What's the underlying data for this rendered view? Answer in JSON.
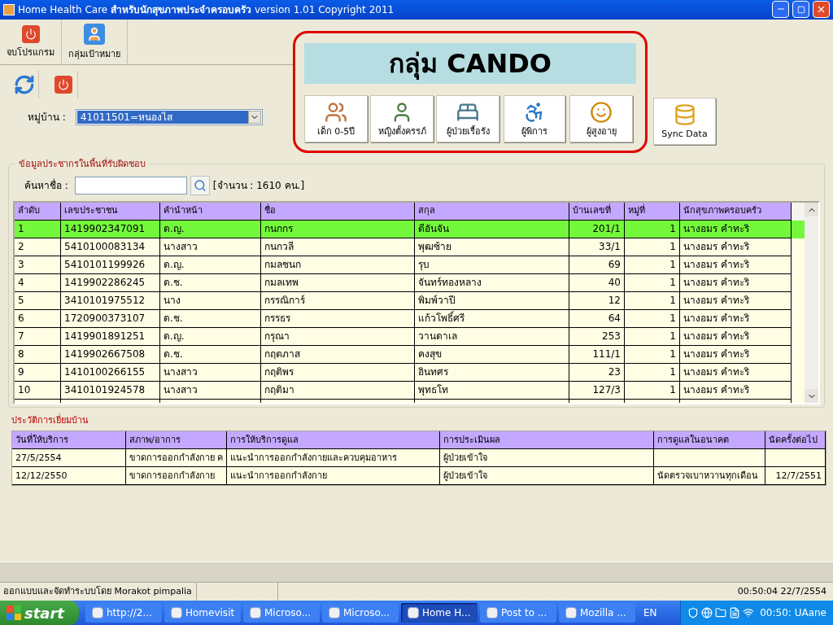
{
  "window": {
    "title": "Home Health Care **สำหรับนักสุขภาพประจำครอบครัว** version 1.01  Copyright 2011"
  },
  "toolbar": [
    {
      "label": "จบโปรแกรม",
      "kind": "power"
    },
    {
      "label": "กลุ่มเป้าหมาย",
      "kind": "person"
    }
  ],
  "village": {
    "label": "หมู่บ้าน :",
    "value": "41011501=หนองไส"
  },
  "cando": {
    "title": "กลุ่ม CANDO",
    "groups": [
      {
        "label": "เด็ก 0-5ปี",
        "kind": "children"
      },
      {
        "label": "หญิงตั้งครรภ์",
        "kind": "woman"
      },
      {
        "label": "ผู้ป่วยเรื้อรัง",
        "kind": "patient"
      },
      {
        "label": "ผู้พิการ",
        "kind": "disabled"
      },
      {
        "label": "ผู้สูงอายุ",
        "kind": "elder"
      }
    ],
    "sync_button": "Sync Data"
  },
  "population": {
    "legend": "ข้อมูลประชากรในพื้นที่รับผิดชอบ",
    "search": {
      "label": "ค้นหาชื่อ :"
    },
    "count": "[จำนวน : 1610 คน.]",
    "table": {
      "columns": [
        "ลำดับ",
        "เลขประชาชน",
        "คำนำหน้า",
        "ชื่อ",
        "สกุล",
        "บ้านเลขที่",
        "หมู่ที่",
        "นักสุขภาพครอบครัว"
      ],
      "rows": [
        {
          "selected": true,
          "cells": [
            "1",
            "1419902347091",
            "ด.ญ.",
            "กนกกร",
            "ดีอันจัน",
            "201/1",
            "1",
            "นางอมร  คำทะริ"
          ]
        },
        {
          "selected": false,
          "cells": [
            "2",
            "5410100083134",
            "นางสาว",
            "กนกวลี",
            "พุฒซ้าย",
            "33/1",
            "1",
            "นางอมร  คำทะริ"
          ]
        },
        {
          "selected": false,
          "cells": [
            "3",
            "5410101199926",
            "ด.ญ.",
            "กมลชนก",
            "รุบ",
            "69",
            "1",
            "นางอมร  คำทะริ"
          ]
        },
        {
          "selected": false,
          "cells": [
            "4",
            "1419902286245",
            "ด.ช.",
            "กมลเทพ",
            "จันทร์ทองหลาง",
            "40",
            "1",
            "นางอมร  คำทะริ"
          ]
        },
        {
          "selected": false,
          "cells": [
            "5",
            "3410101975512",
            "นาง",
            "กรรณิการ์",
            "พิมพ์วาปี",
            "12",
            "1",
            "นางอมร  คำทะริ"
          ]
        },
        {
          "selected": false,
          "cells": [
            "6",
            "1720900373107",
            "ด.ช.",
            "กรรธร",
            "แก้วโพธิ์ศรี",
            "64",
            "1",
            "นางอมร  คำทะริ"
          ]
        },
        {
          "selected": false,
          "cells": [
            "7",
            "1419901891251",
            "ด.ญ.",
            "กรุณา",
            "วานดาเล",
            "253",
            "1",
            "นางอมร  คำทะริ"
          ]
        },
        {
          "selected": false,
          "cells": [
            "8",
            "1419902667508",
            "ด.ช.",
            "กฤตภาส",
            "คงสุข",
            "111/1",
            "1",
            "นางอมร  คำทะริ"
          ]
        },
        {
          "selected": false,
          "cells": [
            "9",
            "1410100266155",
            "นางสาว",
            "กฤติพร",
            "อินทศร",
            "23",
            "1",
            "นางอมร  คำทะริ"
          ]
        },
        {
          "selected": false,
          "cells": [
            "10",
            "3410101924578",
            "นางสาว",
            "กฤติมา",
            "พุทธโท",
            "127/3",
            "1",
            "นางอมร  คำทะริ"
          ]
        }
      ]
    }
  },
  "history": {
    "title": "ประวัติการเยี่ยมบ้าน",
    "table": {
      "columns": [
        "วันที่ให้บริการ",
        "สภาพ/อาการ",
        "การให้บริการดูแล",
        "การประเมินผล",
        "การดูแลในอนาคต",
        "นัดครั้งต่อไป"
      ],
      "rows": [
        {
          "cells": [
            "27/5/2554",
            "ขาดการออกกำลังกาย ค",
            "แนะนำการออกกำลังกายและควบคุมอาหาร",
            "ผู้ป่วยเข้าใจ",
            "",
            ""
          ]
        },
        {
          "cells": [
            "12/12/2550",
            "ขาดการออกกำลังกาย",
            "แนะนำการออกกำลังกาย",
            "ผู้ป่วยเข้าใจ",
            "นัดตรวจเบาหวานทุกเดือน",
            "12/7/2551"
          ]
        }
      ]
    }
  },
  "status_bar": [
    "ออกแบบและจัดทำระบบโดย Morakot pimpalia",
    "00:50:04 22/7/2554"
  ],
  "taskbar": {
    "start": "start",
    "items": [
      {
        "label": "http://2...",
        "selected": false
      },
      {
        "label": "Homevisit",
        "selected": false
      },
      {
        "label": "Microso...",
        "selected": false
      },
      {
        "label": "Microso...",
        "selected": false
      },
      {
        "label": "Home H...",
        "selected": true
      },
      {
        "label": "Post to ...",
        "selected": false
      },
      {
        "label": "Mozilla ...",
        "selected": false
      }
    ],
    "language": "EN",
    "clock": "00:50: UAane"
  }
}
